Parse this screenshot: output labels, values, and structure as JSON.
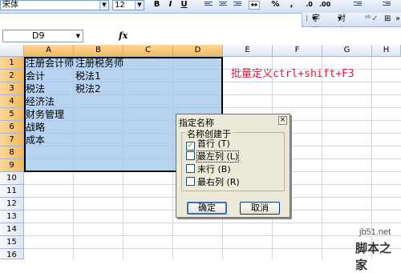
{
  "toolbar": {
    "font_name": "宋体",
    "font_size": "12",
    "bold": "B",
    "italic": "I",
    "underline": "U",
    "percent": "%",
    "comma": ","
  },
  "toolbar2": {
    "font_label": "字体",
    "align_label": "对齐"
  },
  "formula_bar": {
    "name_box": "D9",
    "fx": "fx"
  },
  "columns": [
    "A",
    "B",
    "C",
    "D",
    "E",
    "F",
    "G",
    "H"
  ],
  "rows": [
    "1",
    "2",
    "3",
    "4",
    "5",
    "6",
    "7",
    "8",
    "9",
    "10",
    "11",
    "12",
    "13",
    "14",
    "15",
    "16"
  ],
  "cells": {
    "a1": "注册会计师",
    "b1": "注册税务师",
    "a2": "会计",
    "b2": "税法1",
    "a3": "税法",
    "b3": "税法2",
    "a4": "经济法",
    "a5": "财务管理",
    "a6": "战略",
    "a7": "成本"
  },
  "annotation": "批量定义ctrl+shift+F3",
  "dialog": {
    "title": "指定名称",
    "close": "×",
    "group_label": "名称创建于",
    "options": [
      {
        "label": "首行 (T)",
        "checked": true
      },
      {
        "label": "最左列 (L)",
        "checked": false
      },
      {
        "label": "末行 (B)",
        "checked": false
      },
      {
        "label": "最右列 (R)",
        "checked": false
      }
    ],
    "ok": "确定",
    "cancel": "取消"
  },
  "watermark": {
    "site": "jb51.net",
    "name": "脚本之家"
  }
}
